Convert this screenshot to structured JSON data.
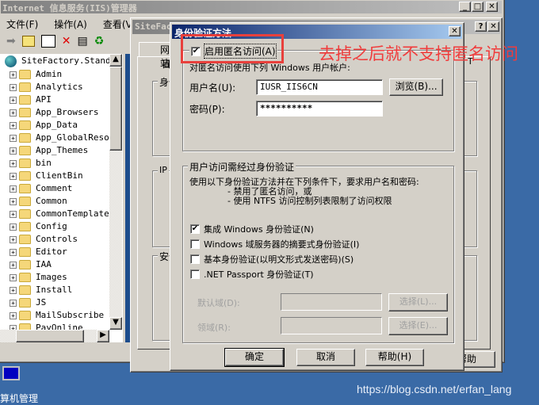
{
  "main_window": {
    "title": "Internet 信息服务(IIS)管理器",
    "menu": [
      "文件(F)",
      "操作(A)",
      "查看(V)"
    ]
  },
  "tree": {
    "root": "SiteFactory.Standa",
    "items": [
      "Admin",
      "Analytics",
      "API",
      "App_Browsers",
      "App_Data",
      "App_GlobalResou",
      "App_Themes",
      "bin",
      "ClientBin",
      "Comment",
      "Common",
      "CommonTemplate",
      "Config",
      "Controls",
      "Editor",
      "IAA",
      "Images",
      "Install",
      "JS",
      "MailSubscribe",
      "PayOnline"
    ]
  },
  "props_dialog": {
    "title": "SiteFac",
    "tab_partial": "网站",
    "sub_partial": "目",
    "group1": "身份",
    "group2": "IP",
    "group3": "安全",
    "tab_right": "T",
    "help_partial": "帮助"
  },
  "auth_dialog": {
    "title": "身份验证方法",
    "anonymous": {
      "label": "启用匿名访问(A)",
      "checked": true,
      "desc": "对匿名访问使用下列 Windows 用户帐户:",
      "username_label": "用户名(U):",
      "username": "IUSR_IIS6CN",
      "password_label": "密码(P):",
      "password": "**********",
      "browse": "浏览(B)..."
    },
    "auth_group": {
      "title": "用户访问需经过身份验证",
      "desc": "使用以下身份验证方法并在下列条件下，要求用户名和密码:",
      "cond1": "- 禁用了匿名访问，或",
      "cond2": "- 使用 NTFS 访问控制列表限制了访问权限",
      "options": [
        {
          "label": "集成 Windows 身份验证(N)",
          "checked": true
        },
        {
          "label": "Windows 域服务器的摘要式身份验证(I)",
          "checked": false
        },
        {
          "label": "基本身份验证(以明文形式发送密码)(S)",
          "checked": false
        },
        {
          "label": ".NET Passport 身份验证(T)",
          "checked": false
        }
      ],
      "default_domain_label": "默认域(D):",
      "realm_label": "领域(R):",
      "select1": "选择(L)...",
      "select2": "选择(E)..."
    },
    "ok": "确定",
    "cancel": "取消",
    "help": "帮助(H)"
  },
  "annotation": {
    "text": "去掉之后就不支持匿名访问",
    "color": "#f03c3c"
  },
  "desktop_icon": "算机管理",
  "watermark": "https://blog.csdn.net/erfan_lang"
}
